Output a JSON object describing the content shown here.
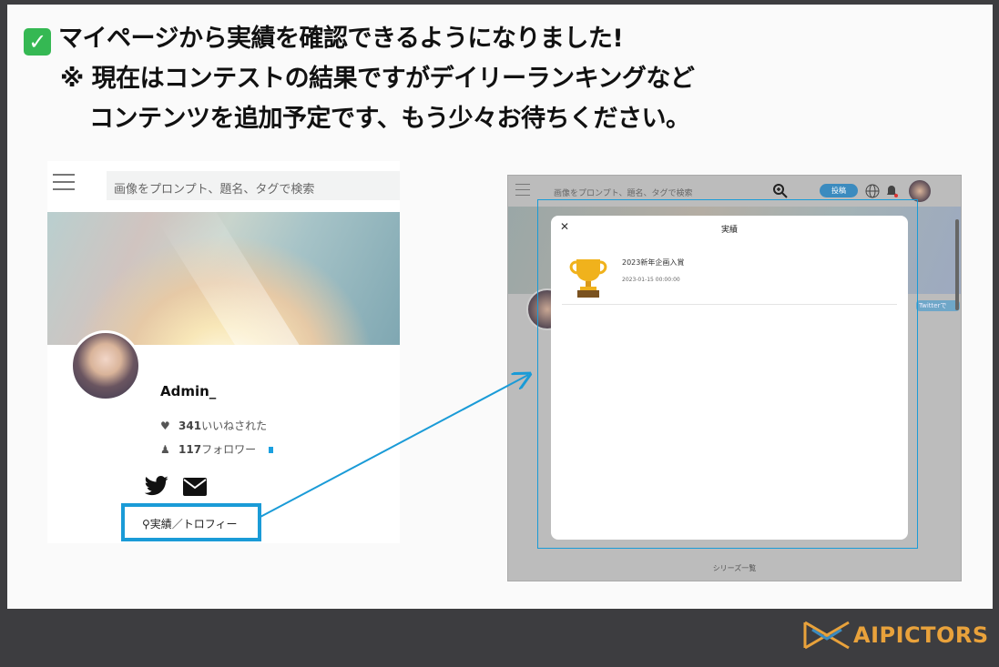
{
  "heading": {
    "line1": "マイページから実績を確認できるようになりました!",
    "line2": "※ 現在はコンテストの結果ですがデイリーランキングなど",
    "line3": "コンテンツを追加予定です、もう少々お待ちください。"
  },
  "left_panel": {
    "search_placeholder": "画像をプロンプト、題名、タグで検索",
    "username": "Admin_",
    "likes_count": "341",
    "likes_label": "いいねされた",
    "followers_count": "117",
    "followers_label": "フォロワー",
    "trophy_link": "実績／トロフィー"
  },
  "right_panel": {
    "search_placeholder": "画像をプロンプト、題名、タグで検索",
    "post_button": "投稿",
    "twitter_button": "Twitterで",
    "series_label": "シリーズ一覧",
    "modal": {
      "close": "✕",
      "title": "実績",
      "achievement_name": "2023新年企画入賞",
      "achievement_date": "2023-01-15 00:00:00"
    }
  },
  "footer": {
    "brand": "AIPICTORS",
    "brand_color": "#e9a23b"
  },
  "colors": {
    "highlight": "#1a9bd7",
    "check_green": "#35b853"
  }
}
